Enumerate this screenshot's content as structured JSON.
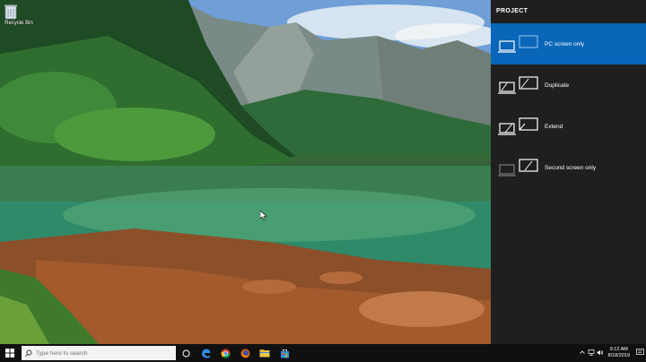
{
  "desktop": {
    "recycle_bin_label": "Recycle Bin"
  },
  "project_panel": {
    "title": "PROJECT",
    "options": [
      {
        "label": "PC screen only",
        "selected": true
      },
      {
        "label": "Duplicate",
        "selected": false
      },
      {
        "label": "Extend",
        "selected": false
      },
      {
        "label": "Second screen only",
        "selected": false
      }
    ]
  },
  "taskbar": {
    "search_placeholder": "Type here to search",
    "clock_time": "9:12 AM",
    "clock_date": "8/18/2019",
    "icons": [
      "windows-start-icon",
      "search-icon",
      "cortana-icon",
      "edge-icon",
      "chrome-icon",
      "firefox-icon",
      "file-explorer-icon",
      "store-icon"
    ]
  },
  "colors": {
    "panel_bg": "#1f1f1f",
    "selected_bg": "#0a66b8",
    "taskbar_bg": "#101010"
  }
}
